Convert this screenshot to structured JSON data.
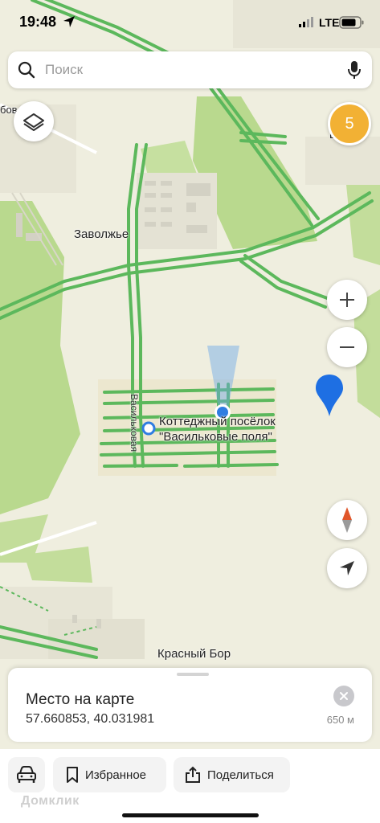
{
  "status_bar": {
    "time": "19:48",
    "network": "LTE"
  },
  "search": {
    "placeholder": "Поиск"
  },
  "map": {
    "cluster_badge": "5",
    "labels": {
      "zavolzhye": "Заволжье",
      "cottage_line1": "Коттеджный посёлок",
      "cottage_line2": "\"Васильковые поля\"",
      "street": "Васильковая",
      "krasny_bor": "Красный Бор",
      "edge_left": "бов",
      "edge_right": "В"
    }
  },
  "controls": {
    "layers": "layers-icon",
    "zoom_in": "plus-icon",
    "zoom_out": "minus-icon",
    "compass": "compass-icon",
    "my_location": "navigation-arrow-icon"
  },
  "place_card": {
    "title": "Место на карте",
    "coordinates": "57.660853, 40.031981",
    "distance": "650 м"
  },
  "bottom_bar": {
    "favorites_label": "Избранное",
    "share_label": "Поделиться",
    "watermark": "Домклик"
  },
  "colors": {
    "background": "#efeedf",
    "park": "#b9d98e",
    "road": "#5cb85c",
    "marker": "#1e6fe3",
    "badge": "#f2b134"
  }
}
